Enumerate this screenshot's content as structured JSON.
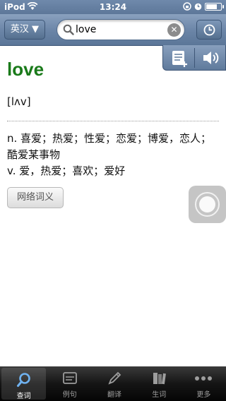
{
  "status_bar": {
    "carrier": "iPod",
    "time": "13:24"
  },
  "header": {
    "lang_button": "英汉 ▼",
    "search": {
      "value": "love",
      "placeholder": ""
    },
    "clear_glyph": "✕"
  },
  "entry": {
    "word": "love",
    "phonetic": "[lʌv]",
    "definitions": [
      "n. 喜爱；热爱；性爱；恋爱；博爱，恋人；酷爱某事物",
      "v. 爱，热爱；喜欢；爱好"
    ],
    "web_def_button": "网络词义"
  },
  "tabs": [
    {
      "label": "查词",
      "icon": "search-icon",
      "active": true
    },
    {
      "label": "例句",
      "icon": "example-icon",
      "active": false
    },
    {
      "label": "翻译",
      "icon": "translate-pen-icon",
      "active": false
    },
    {
      "label": "生词",
      "icon": "wordbook-icon",
      "active": false
    },
    {
      "label": "更多",
      "icon": "more-dots-icon",
      "active": false
    }
  ],
  "colors": {
    "accent_header": "#6a84a6",
    "word_green": "#1a7a1a",
    "tab_bar": "#151515"
  }
}
